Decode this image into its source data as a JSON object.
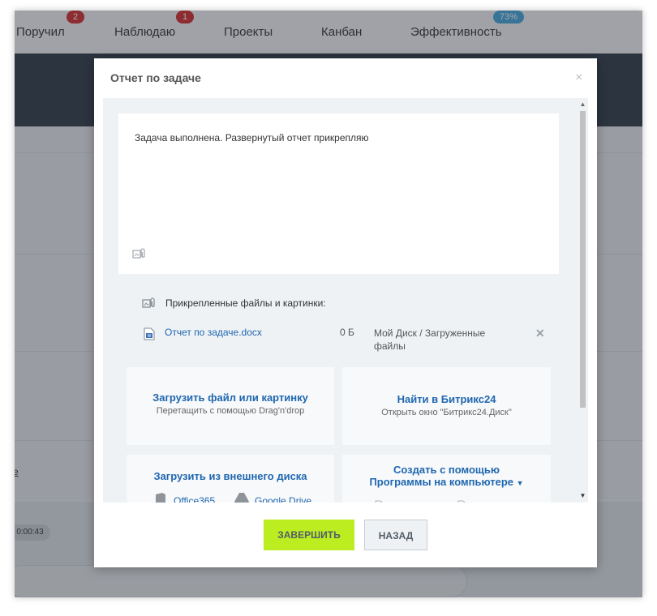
{
  "topnav": {
    "items": [
      {
        "label": "Поручил",
        "badge": "2"
      },
      {
        "label": "Наблюдаю",
        "badge": "1"
      },
      {
        "label": "Проекты"
      },
      {
        "label": "Канбан"
      },
      {
        "label": "Эффективность",
        "badge": "73%"
      }
    ]
  },
  "background": {
    "timer": "0:00:43",
    "side_text": "е"
  },
  "modal": {
    "title": "Отчет по задаче",
    "close_symbol": "×",
    "editor_text": "Задача выполнена. Развернутый отчет прикрепляю",
    "attachments_label": "Прикрепленные файлы и картинки:",
    "file": {
      "name": "Отчет по задаче.docx",
      "size": "0 Б",
      "path": "Мой Диск / Загруженные файлы"
    },
    "tiles": {
      "upload_title": "Загрузить файл или картинку",
      "upload_sub": "Перетащить с помощью Drag'n'drop",
      "find_title": "Найти в Битрикс24",
      "find_sub": "Открыть окно \"Битрикс24.Диск\"",
      "external_title": "Загрузить из внешнего диска",
      "service_office": "Office365",
      "service_gdrive": "Google Drive",
      "create_title_line1": "Создать с помощью",
      "create_title_line2": "Программы на компьютере"
    },
    "buttons": {
      "finish": "ЗАВЕРШИТЬ",
      "back": "НАЗАД"
    }
  },
  "colors": {
    "finish_button": "#bbed21",
    "link": "#2067b0",
    "badge_red": "#d62e2e",
    "badge_blue": "#42a8dc"
  }
}
